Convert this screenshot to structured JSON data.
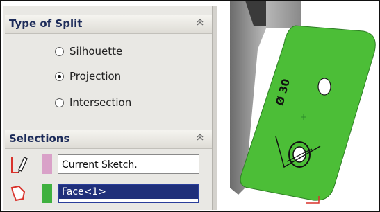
{
  "type_of_split": {
    "title": "Type of Split",
    "collapse_glyph": "⌃",
    "options": [
      {
        "label": "Silhouette",
        "checked": false
      },
      {
        "label": "Projection",
        "checked": true
      },
      {
        "label": "Intersection",
        "checked": false
      }
    ]
  },
  "selections": {
    "title": "Selections",
    "collapse_glyph": "⌃",
    "sketch_field": {
      "value": "Current Sketch.",
      "icon": "pencil-icon",
      "swatch_color": "#d9a1c8"
    },
    "face_field": {
      "value": "Face<1>",
      "icon": "face-icon",
      "swatch_color": "#3fb13f"
    }
  },
  "viewport": {
    "dimension_label": "Ø 30",
    "part_color": "#4cbe37"
  }
}
